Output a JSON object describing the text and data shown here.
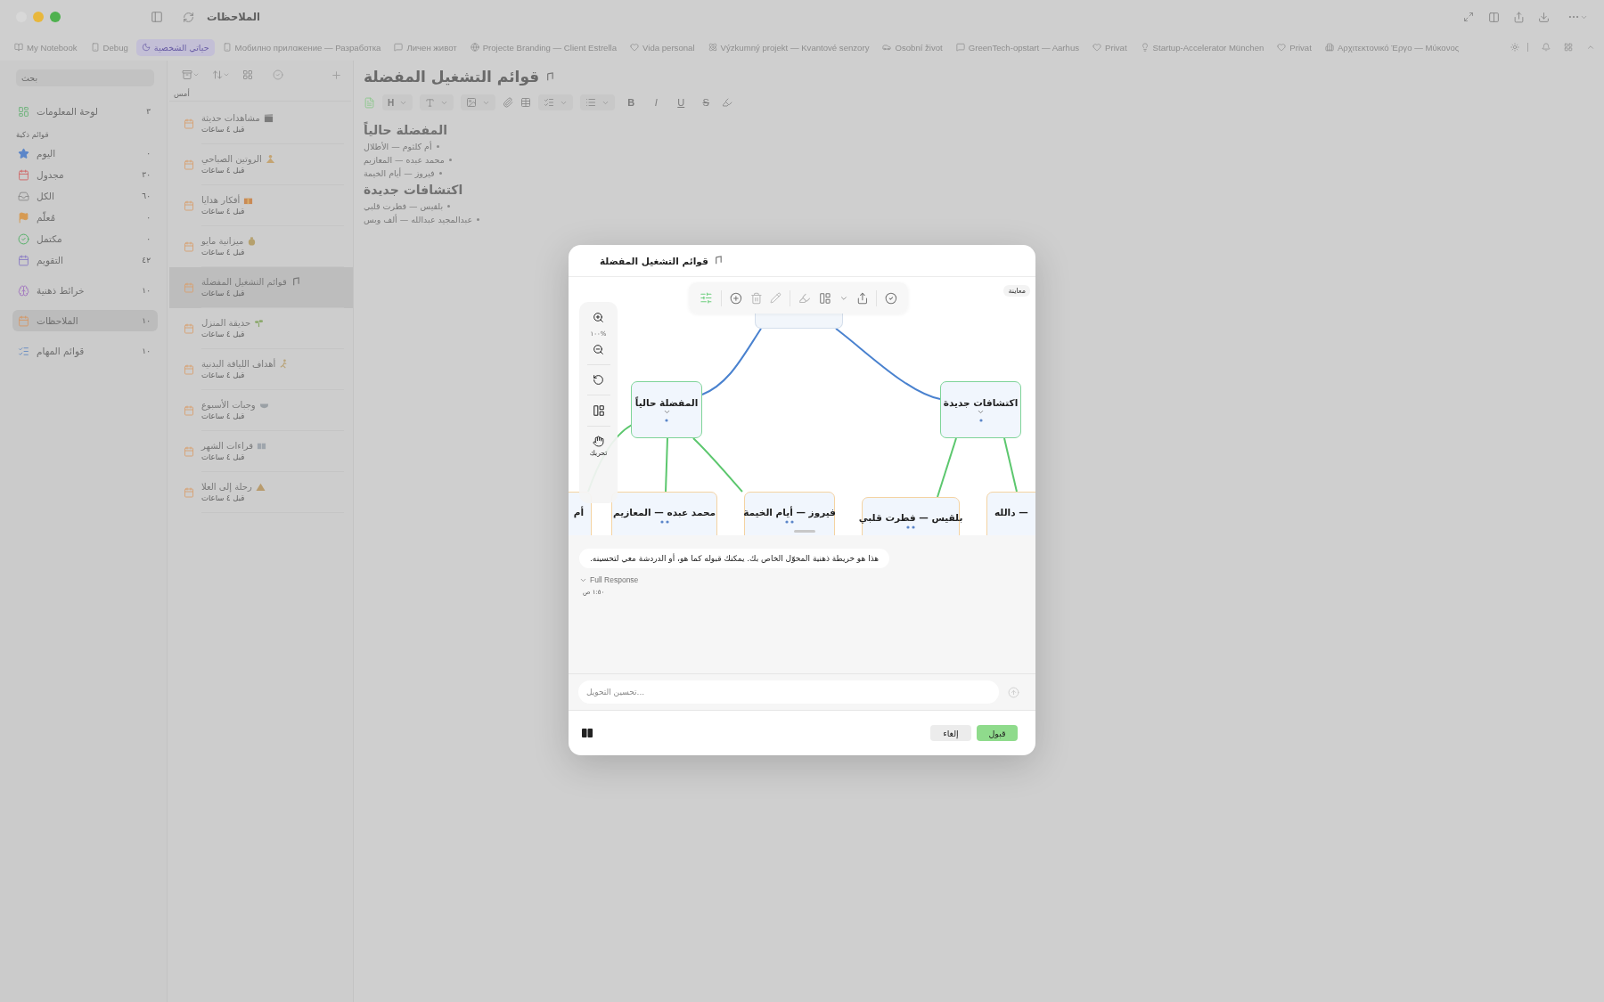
{
  "window": {
    "title": "الملاحظات"
  },
  "tabs": [
    {
      "label": "Αρχιτεκτονικό Έργο — Μύκονος",
      "kind": "buildings",
      "selected": false
    },
    {
      "label": "Privat",
      "kind": "heart",
      "selected": false
    },
    {
      "label": "Startup-Accelerator München",
      "kind": "bulb",
      "selected": false
    },
    {
      "label": "Privat",
      "kind": "heart",
      "selected": false
    },
    {
      "label": "GreenTech-opstart — Aarhus",
      "kind": "chat",
      "selected": false
    },
    {
      "label": "Osobní život",
      "kind": "car",
      "selected": false
    },
    {
      "label": "Výzkumný projekt — Kvantové senzory",
      "kind": "atom",
      "selected": false
    },
    {
      "label": "Vida personal",
      "kind": "heart",
      "selected": false
    },
    {
      "label": "Projecte Branding — Client Estrella",
      "kind": "globe",
      "selected": false
    },
    {
      "label": "Личен живот",
      "kind": "chat",
      "selected": false
    },
    {
      "label": "Мобилно приложение — Разработка",
      "kind": "phone",
      "selected": false
    },
    {
      "label": "حياتي الشخصية",
      "kind": "moon",
      "selected": true
    },
    {
      "label": "Debug",
      "kind": "phone",
      "selected": false
    },
    {
      "label": "My Notebook",
      "kind": "book",
      "selected": false
    }
  ],
  "sidebar": {
    "search_placeholder": "بحث",
    "dashboard": {
      "label": "لوحة المعلومات",
      "count": "٣"
    },
    "smart_lists": {
      "title": "قوائم ذكية",
      "items": [
        {
          "label": "اليوم",
          "count": "٠",
          "kind": "star"
        },
        {
          "label": "مجدول",
          "count": "٣٠",
          "kind": "scheduled"
        },
        {
          "label": "الكل",
          "count": "٦٠",
          "kind": "tray"
        },
        {
          "label": "مُعلّم",
          "count": "٠",
          "kind": "flag"
        },
        {
          "label": "مكتمل",
          "count": "٠",
          "kind": "done"
        },
        {
          "label": "التقويم",
          "count": "٤٢",
          "kind": "calendar"
        }
      ]
    },
    "sections": [
      {
        "label": "خرائط ذهنية",
        "count": "١٠",
        "kind": "brain",
        "selected": false
      },
      {
        "label": "الملاحظات",
        "count": "١٠",
        "kind": "notes",
        "selected": true
      },
      {
        "label": "قوائم المهام",
        "count": "١٠",
        "kind": "tasks",
        "selected": false
      }
    ]
  },
  "note_list": {
    "group": "أمس",
    "notes": [
      {
        "title": "مشاهدات حديثة",
        "time": "قبل ٤ ساعات",
        "kind": "clapper",
        "selected": false
      },
      {
        "title": "الروتين الصباحي",
        "time": "قبل ٤ ساعات",
        "kind": "lotus",
        "selected": false
      },
      {
        "title": "أفكار هدايا",
        "time": "قبل ٤ ساعات",
        "kind": "gift",
        "selected": false
      },
      {
        "title": "ميزانية مايو",
        "time": "قبل ٤ ساعات",
        "kind": "moneybag",
        "selected": false
      },
      {
        "title": "قوائم التشغيل المفضلة",
        "time": "قبل ٤ ساعات",
        "kind": "music",
        "selected": true
      },
      {
        "title": "حديقة المنزل",
        "time": "قبل ٤ ساعات",
        "kind": "sprout",
        "selected": false
      },
      {
        "title": "أهداف اللياقة البدنية",
        "time": "قبل ٤ ساعات",
        "kind": "runner",
        "selected": false
      },
      {
        "title": "وجبات الأسبوع",
        "time": "قبل ٤ ساعات",
        "kind": "bowl",
        "selected": false
      },
      {
        "title": "قراءات الشهر",
        "time": "قبل ٤ ساعات",
        "kind": "book",
        "selected": false
      },
      {
        "title": "رحلة إلى العلا",
        "time": "قبل ٤ ساعات",
        "kind": "mountain",
        "selected": false
      }
    ]
  },
  "editor": {
    "title": "قوائم التشغيل المفضلة",
    "toolbar": {
      "heading": "H",
      "marks": [
        {
          "label": "S",
          "kind": "strike"
        },
        {
          "label": "U",
          "kind": "underline"
        },
        {
          "label": "I",
          "kind": "italic"
        },
        {
          "label": "B",
          "kind": "bold"
        }
      ]
    },
    "blocks": [
      {
        "kind": "heading",
        "text": "المفضلة حالياً"
      },
      {
        "kind": "bullet",
        "text": "أم كلثوم — الأطلال"
      },
      {
        "kind": "bullet",
        "text": "محمد عبده — المعازيم"
      },
      {
        "kind": "bullet",
        "text": "فيروز — أيام الخيمة"
      },
      {
        "kind": "heading",
        "text": "اكتشافات جديدة"
      },
      {
        "kind": "bullet",
        "text": "بلقيس — فطرت قلبي"
      },
      {
        "kind": "bullet",
        "text": "عبدالمجيد عبدالله — ألف وبس"
      }
    ]
  },
  "dialog": {
    "title": "قوائم التشغيل المفضلة",
    "preview": "معاينة",
    "zoom": "١٠٠%",
    "pan_label": "تحريك",
    "mindmap": {
      "children": [
        {
          "text": "اكتشافات جديدة",
          "children": [
            {
              "text": "دالله —"
            },
            {
              "text": "بلقيس — فطرت قلبي"
            }
          ]
        },
        {
          "text": "المفضلة حالياً",
          "children": [
            {
              "text": "فيروز — أيام الخيمة"
            },
            {
              "text": "محمد عبده — المعازيم"
            },
            {
              "text": "أم"
            }
          ]
        }
      ]
    },
    "message": "هذا هو خريطة ذهنية المحوّل الخاص بك. يمكنك قبوله كما هو، أو الدردشة معي لتحسينه.",
    "full_response": "Full Response",
    "time": "١:٥٠ ص",
    "input_placeholder": "تحسين التحويل...",
    "buttons": [
      {
        "label": "قبول",
        "kind": "primary"
      },
      {
        "label": "إلغاء",
        "kind": "secondary"
      }
    ]
  }
}
